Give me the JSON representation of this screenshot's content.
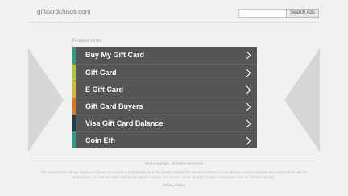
{
  "header": {
    "domain": "giftcardchaos.com",
    "search_placeholder": "",
    "search_button_label": "Search Ads"
  },
  "related": {
    "label": "Related Links",
    "items": [
      {
        "label": "Buy My Gift Card",
        "accent": "#2e9b8a"
      },
      {
        "label": "Gift Card",
        "accent": "#b3c53a"
      },
      {
        "label": "E Gift Card",
        "accent": "#d6b92a"
      },
      {
        "label": "Gift Card Buyers",
        "accent": "#d9772a"
      },
      {
        "label": "Visa Gift Card Balance",
        "accent": "#1f3f5a"
      },
      {
        "label": "Coin Eth",
        "accent": "#2e9b8a"
      }
    ],
    "chevron_icon": "chevron-right-icon"
  },
  "nav_arrows": {
    "left_icon": "arrow-left-icon",
    "right_icon": "arrow-right-icon",
    "color": "#d6d6d6"
  },
  "footer": {
    "copyright": "2018 Copyright. All Rights Reserved.",
    "disclaimer": "The Sponsored Listings displayed above are served automatically by a third party. Neither the service provider nor the domain owner maintain any relationship with the advertisers. In case of trademark issues please contact the domain owner directly (contact information can be found in whois).",
    "privacy_label": "Privacy Policy"
  }
}
